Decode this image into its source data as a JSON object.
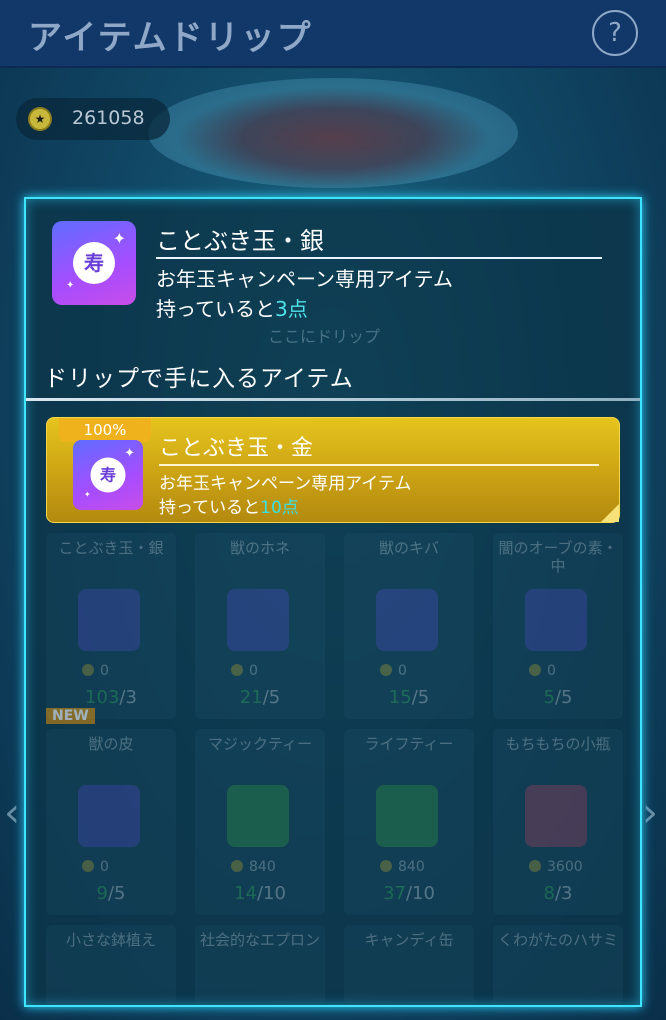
{
  "header": {
    "title": "アイテムドリップ",
    "help_label": "?"
  },
  "coins": {
    "icon": "coin-icon",
    "value": "261058"
  },
  "source_item": {
    "name": "ことぶき玉・銀",
    "icon_glyph": "寿",
    "description": "お年玉キャンペーン専用アイテム",
    "points_prefix": "持っていると",
    "points_value": "3点",
    "drop_hint": "ここにドリップ"
  },
  "result_section": {
    "heading": "ドリップで手に入るアイテム",
    "items": [
      {
        "chance": "100%",
        "name": "ことぶき玉・金",
        "icon_glyph": "寿",
        "description": "お年玉キャンペーン専用アイテム",
        "points_prefix": "持っていると",
        "points_value": "10点"
      }
    ]
  },
  "background_grid": {
    "rows": [
      [
        {
          "name": "ことぶき玉・銀",
          "cost": "0",
          "have": "103",
          "need": "/3"
        },
        {
          "name": "獣のホネ",
          "cost": "0",
          "have": "21",
          "need": "/5"
        },
        {
          "name": "獣のキバ",
          "cost": "0",
          "have": "15",
          "need": "/5"
        },
        {
          "name": "闇のオーブの素・中",
          "cost": "0",
          "have": "5",
          "need": "/5"
        }
      ],
      [
        {
          "name": "獣の皮",
          "cost": "0",
          "have": "9",
          "need": "/5"
        },
        {
          "name": "マジックティー",
          "cost": "840",
          "have": "14",
          "need": "/10"
        },
        {
          "name": "ライフティー",
          "cost": "840",
          "have": "37",
          "need": "/10"
        },
        {
          "name": "もちもちの小瓶",
          "cost": "3600",
          "have": "8",
          "need": "/3"
        }
      ]
    ],
    "third_row": [
      "小さな鉢植え",
      "社会的なエプロン",
      "キャンディ缶",
      "くわがたのハサミ"
    ],
    "new_badge": "NEW"
  },
  "colors": {
    "panel_border": "#3fe4ff",
    "card_gold": "#e5c41e",
    "points_highlight": "#4ee2e8"
  }
}
